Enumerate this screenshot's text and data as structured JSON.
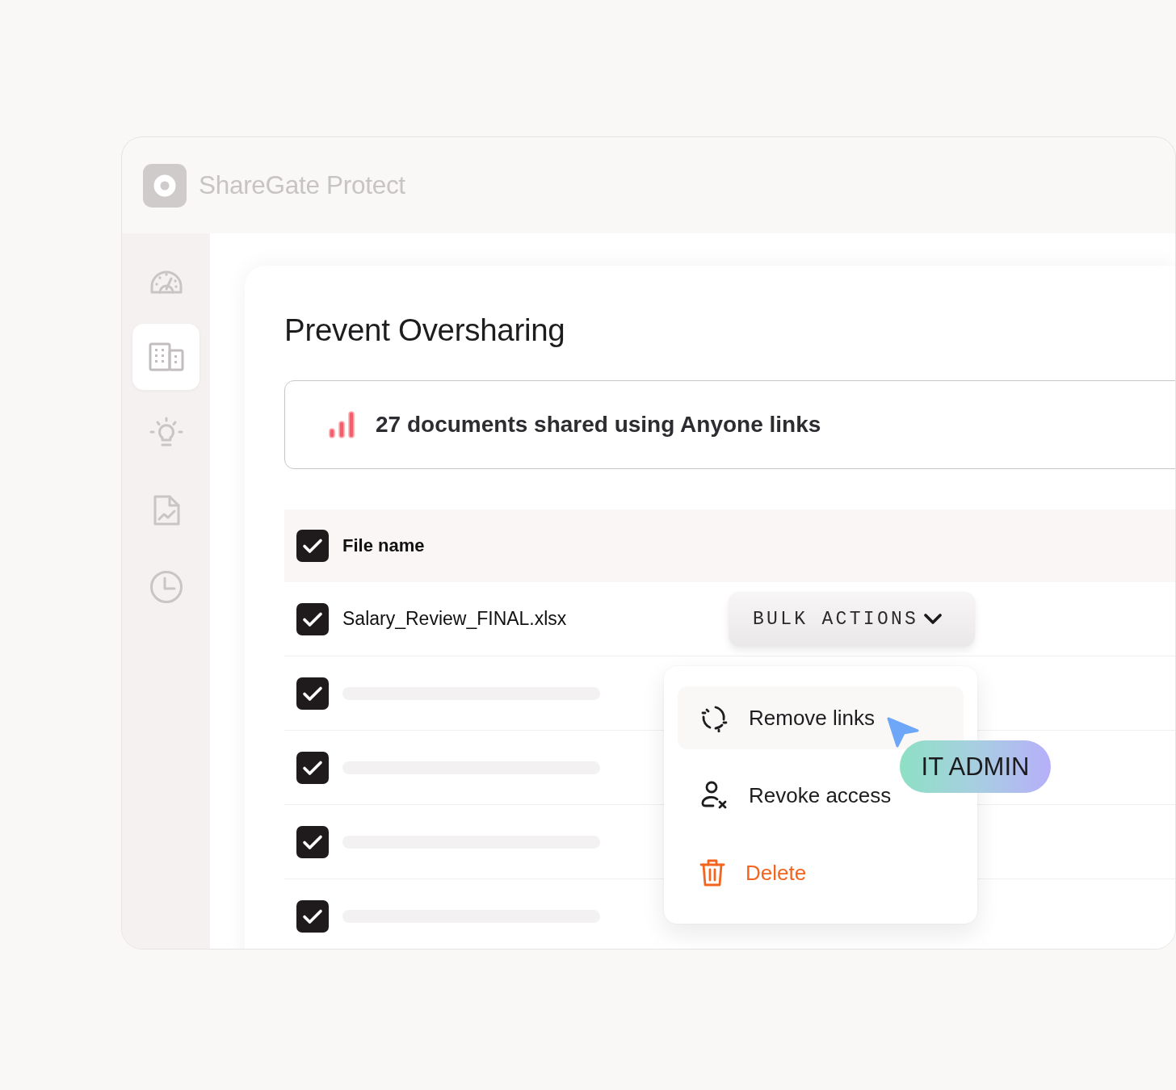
{
  "app": {
    "title": "ShareGate Protect"
  },
  "sidebar": {
    "items": [
      {
        "selected": false
      },
      {
        "selected": true
      },
      {
        "selected": false
      },
      {
        "selected": false
      },
      {
        "selected": false
      }
    ]
  },
  "page": {
    "title": "Prevent Oversharing"
  },
  "alert": {
    "text": "27 documents shared using Anyone links"
  },
  "table": {
    "header": {
      "checked": true,
      "label": "File name"
    },
    "rows": [
      {
        "kind": "file",
        "checked": true,
        "file_name": "Salary_Review_FINAL.xlsx"
      },
      {
        "kind": "placeholder",
        "checked": true
      },
      {
        "kind": "placeholder",
        "checked": true
      },
      {
        "kind": "placeholder",
        "checked": true
      },
      {
        "kind": "placeholder",
        "checked": true
      }
    ],
    "bulk_actions": {
      "label": "BULK ACTIONS",
      "menu": [
        {
          "kind": "action",
          "label": "Remove links",
          "selected": true
        },
        {
          "kind": "action",
          "label": "Revoke access",
          "selected": false
        },
        {
          "kind": "danger",
          "label": "Delete",
          "selected": false
        }
      ]
    }
  },
  "cursor": {
    "label": "IT ADMIN"
  }
}
